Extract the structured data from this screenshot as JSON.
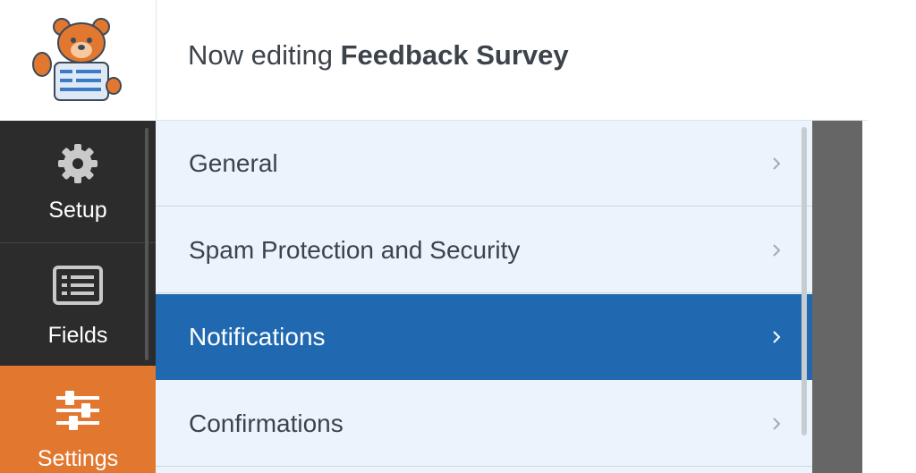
{
  "header": {
    "prefix": "Now editing",
    "form_name": "Feedback Survey"
  },
  "sidebar": {
    "items": [
      {
        "label": "Setup",
        "icon": "gear-icon"
      },
      {
        "label": "Fields",
        "icon": "fields-list-icon"
      },
      {
        "label": "Settings",
        "icon": "sliders-icon",
        "active": true
      }
    ]
  },
  "settings_panel": {
    "items": [
      {
        "label": "General"
      },
      {
        "label": "Spam Protection and Security"
      },
      {
        "label": "Notifications",
        "active": true
      },
      {
        "label": "Confirmations"
      }
    ]
  },
  "colors": {
    "sidebar_bg": "#2c2c2c",
    "sidebar_active": "#e27730",
    "panel_bg": "#ebf3fc",
    "panel_active": "#2069b0",
    "preview_bg": "#666666"
  }
}
